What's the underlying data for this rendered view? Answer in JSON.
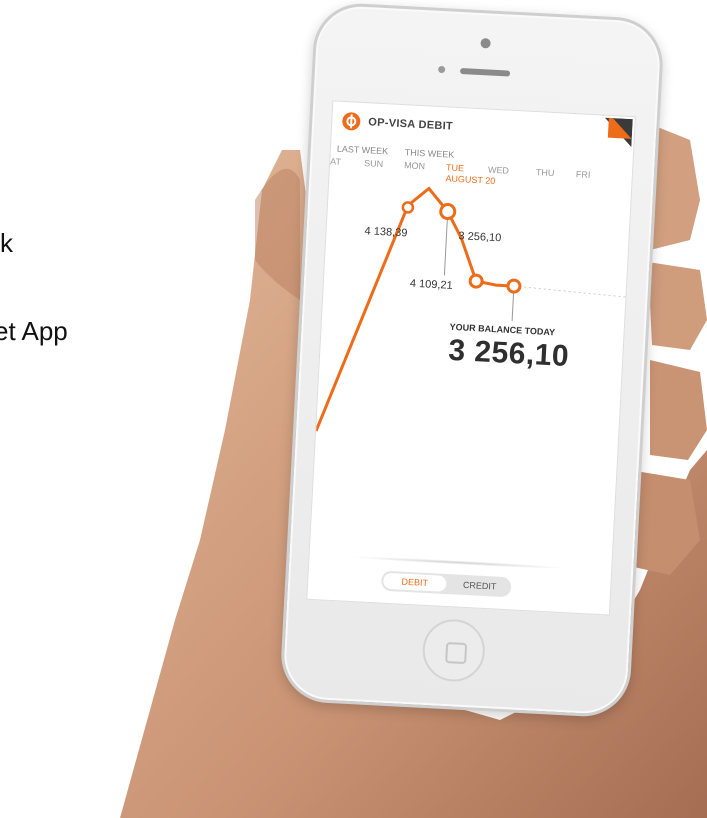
{
  "background_text": [
    {
      "text": "k"
    },
    {
      "text": "et App"
    }
  ],
  "app": {
    "title": "OP-VISA DEBIT",
    "accent_color": "#ee6b1a"
  },
  "week_labels": {
    "last": "LAST WEEK",
    "this": "THIS WEEK"
  },
  "days": [
    "AT",
    "SUN",
    "MON",
    "TUE",
    "WED",
    "THU",
    "FRI"
  ],
  "active_day": "TUE",
  "active_date": "AUGUST 20",
  "values": {
    "v1": "4 138,39",
    "v2": "3 256,10",
    "v3": "4 109,21"
  },
  "balance": {
    "caption": "YOUR BALANCE TODAY",
    "value": "3 256,10"
  },
  "toggle": {
    "debit": "DEBIT",
    "credit": "CREDIT",
    "active": "DEBIT"
  },
  "icons": {
    "logo": "op-logo-icon",
    "corner": "corner-fold-icon"
  }
}
